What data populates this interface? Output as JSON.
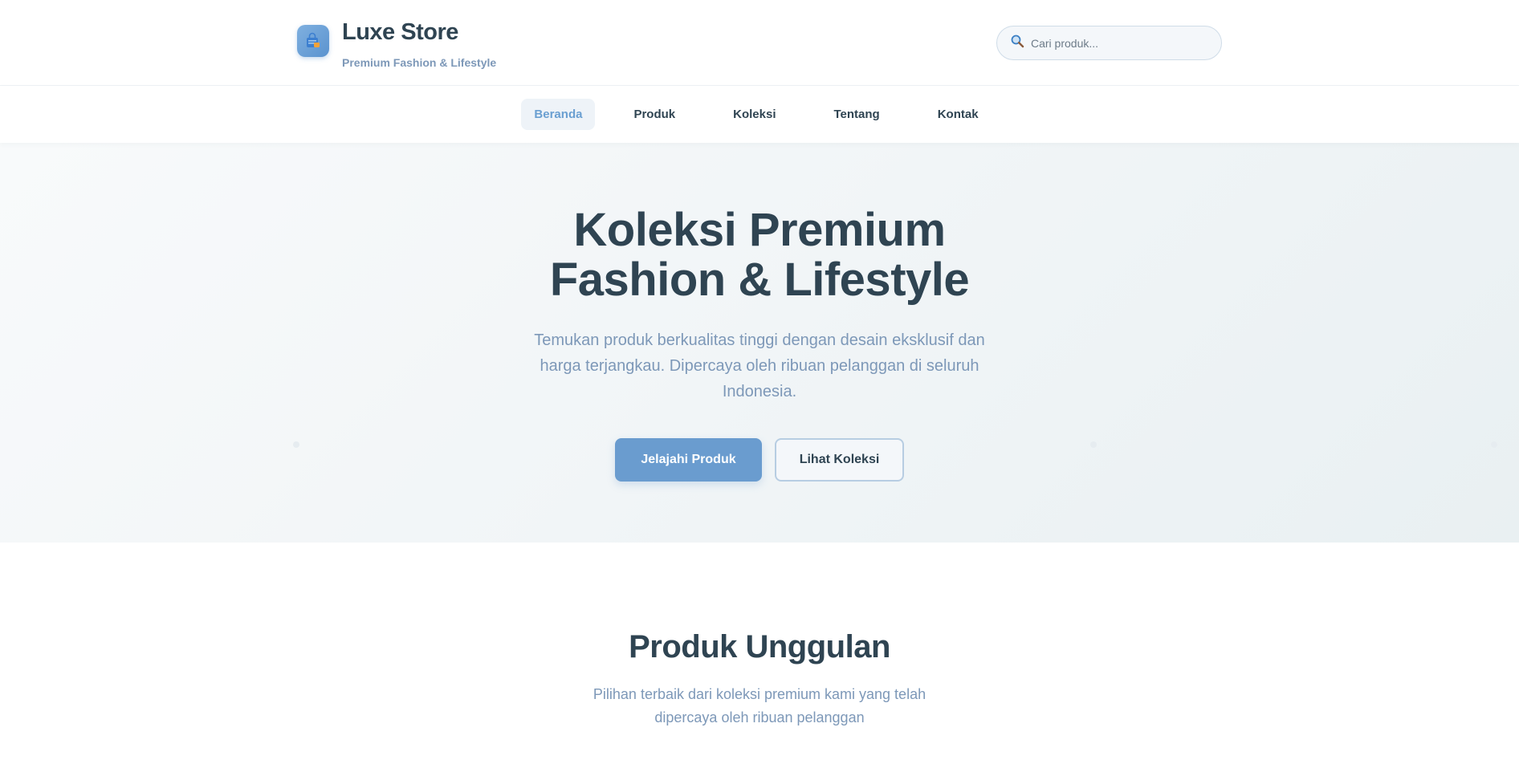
{
  "header": {
    "brand_name": "Luxe Store",
    "brand_tagline": "Premium Fashion & Lifestyle",
    "logo_icon": "shopping-bag-icon",
    "search": {
      "placeholder": "Cari produk...",
      "icon": "search-icon"
    }
  },
  "nav": {
    "items": [
      {
        "label": "Beranda",
        "active": true
      },
      {
        "label": "Produk",
        "active": false
      },
      {
        "label": "Koleksi",
        "active": false
      },
      {
        "label": "Tentang",
        "active": false
      },
      {
        "label": "Kontak",
        "active": false
      }
    ]
  },
  "hero": {
    "title_line1": "Koleksi Premium",
    "title_line2": "Fashion & Lifestyle",
    "subtitle": "Temukan produk berkualitas tinggi dengan desain eksklusif dan harga terjangkau. Dipercaya oleh ribuan pelanggan di seluruh Indonesia.",
    "primary_button": "Jelajahi Produk",
    "secondary_button": "Lihat Koleksi"
  },
  "featured": {
    "title": "Produk Unggulan",
    "subtitle": "Pilihan terbaik dari koleksi premium kami yang telah dipercaya oleh ribuan pelanggan"
  },
  "colors": {
    "accent": "#6a9ccf",
    "text_dark": "#2f4452",
    "text_muted": "#7d98b8"
  }
}
